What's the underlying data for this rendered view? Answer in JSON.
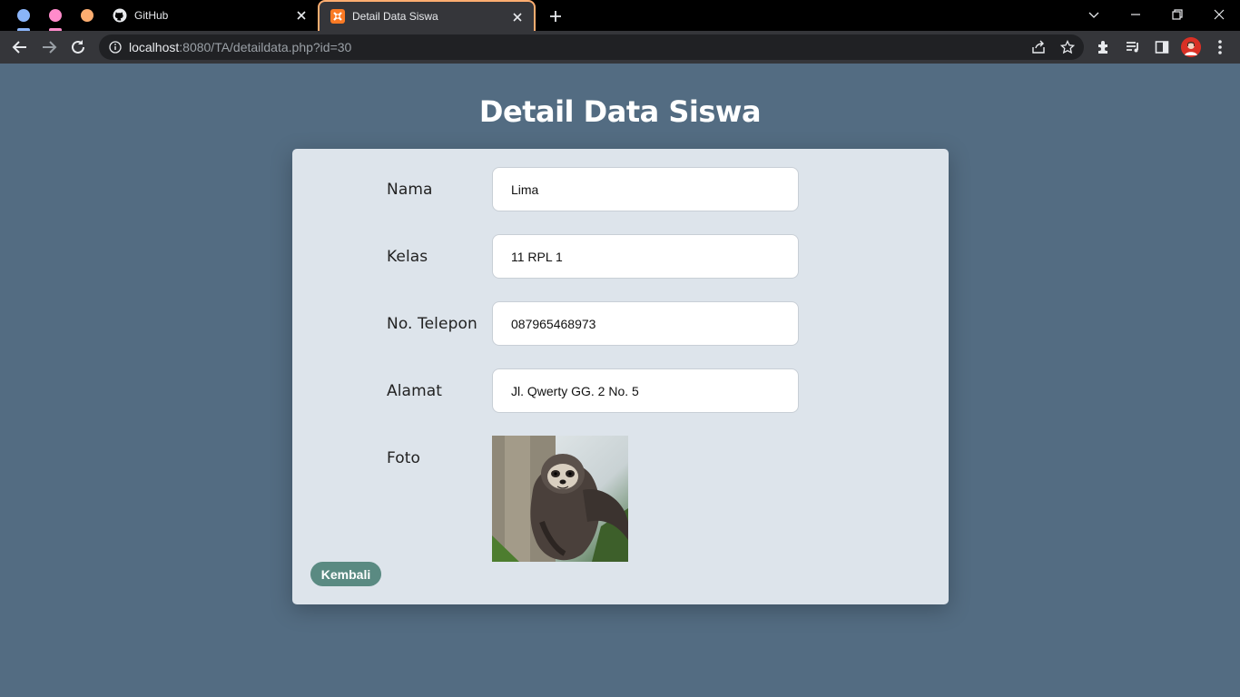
{
  "browser": {
    "tabs": [
      {
        "title": "GitHub"
      },
      {
        "title": "Detail Data Siswa"
      }
    ],
    "url_host": "localhost",
    "url_rest": ":8080/TA/detaildata.php?id=30",
    "colors": {
      "active_tab_border": "#fcad70",
      "group_blue": "#8ab4f8",
      "group_pink": "#ff8bcb",
      "group_orange": "#fcad70"
    }
  },
  "page": {
    "title": "Detail Data Siswa",
    "fields": [
      {
        "label": "Nama",
        "value": "Lima"
      },
      {
        "label": "Kelas",
        "value": "11 RPL 1"
      },
      {
        "label": "No. Telepon",
        "value": "087965468973"
      },
      {
        "label": "Alamat",
        "value": "Jl. Qwerty GG. 2 No. 5"
      }
    ],
    "photo_label": "Foto",
    "back_button": "Kembali",
    "colors": {
      "background": "#536c82",
      "card": "#dde4eb",
      "button": "#5a8a82"
    }
  }
}
